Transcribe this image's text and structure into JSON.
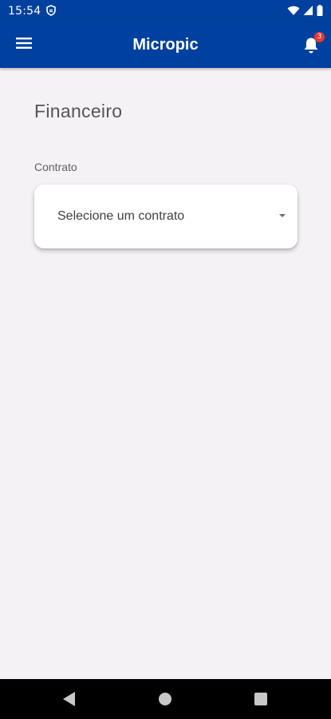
{
  "status_bar": {
    "time": "15:54",
    "app_icon": "shield-icon",
    "indicators": [
      "wifi-icon",
      "signal-icon",
      "battery-icon"
    ]
  },
  "app_bar": {
    "title": "Micropic",
    "menu_icon": "hamburger-menu-icon",
    "notification_icon": "bell-icon",
    "notification_count": "3"
  },
  "main": {
    "page_title": "Financeiro",
    "contract_label": "Contrato",
    "contract_select": {
      "value": "Selecione um contrato",
      "icon": "caret-down-icon"
    }
  },
  "nav_bar": {
    "buttons": [
      "back-icon",
      "home-icon",
      "recents-icon"
    ]
  },
  "colors": {
    "primary": "#00409e",
    "background": "#f4f2f4",
    "badge": "#e53935",
    "card": "#ffffff"
  }
}
